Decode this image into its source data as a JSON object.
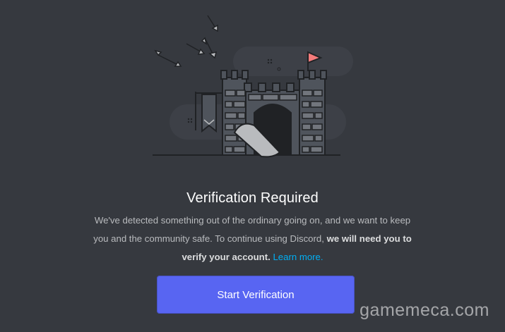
{
  "dialog": {
    "title": "Verification Required",
    "message_part1": "We've detected something out of the ordinary going on, and we want to keep you and the community safe. To continue using Discord,",
    "message_bold": "we will need you to verify your account.",
    "learn_more_label": "Learn more.",
    "cta_label": "Start Verification"
  },
  "illustration": {
    "name": "castle-under-attack-illustration",
    "flag_color": "#f47b7b",
    "stone_colors": [
      "#4f545c",
      "#72767d",
      "#202225"
    ]
  },
  "watermark": {
    "text": "gamemeca.com"
  },
  "colors": {
    "background": "#36393f",
    "accent": "#5865f2",
    "link": "#00aff4"
  }
}
